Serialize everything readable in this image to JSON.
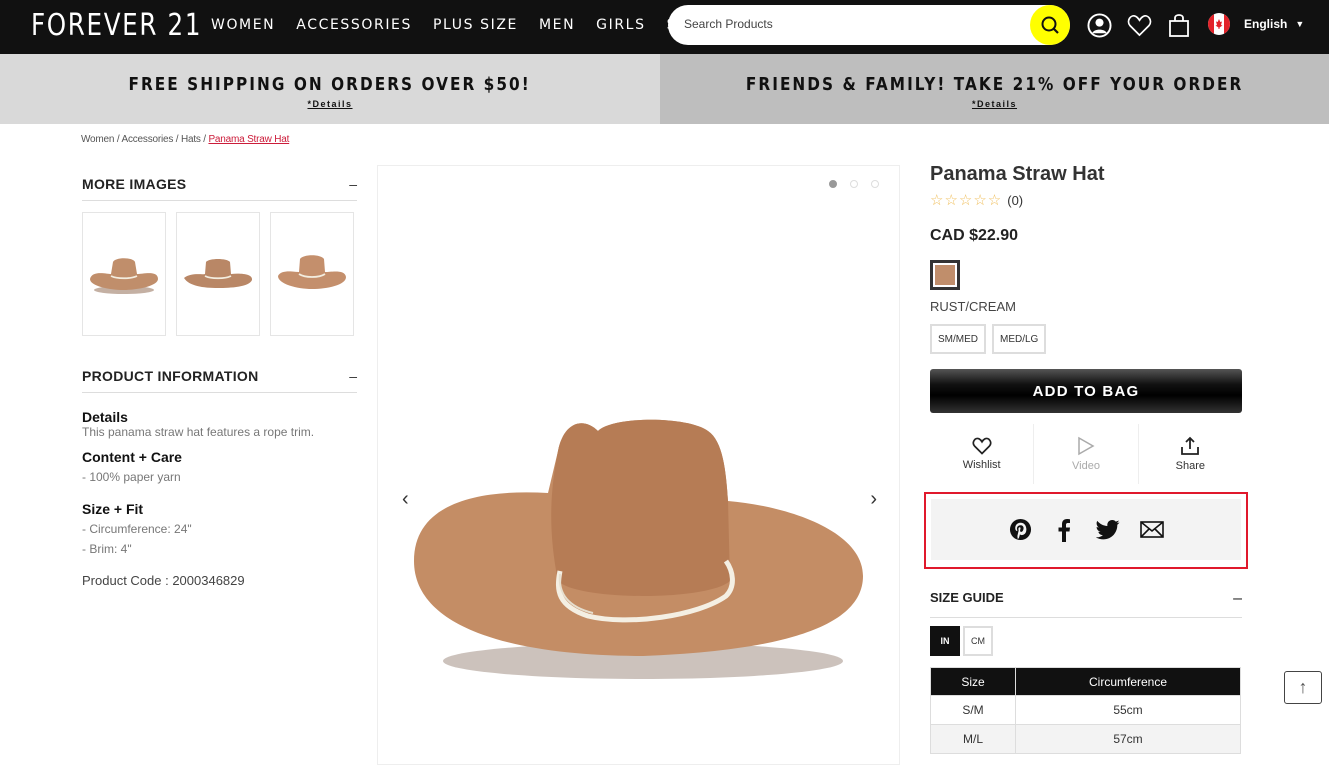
{
  "header": {
    "logo": "FOREVER 21",
    "nav": [
      "WOMEN",
      "ACCESSORIES",
      "PLUS SIZE",
      "MEN",
      "GIRLS",
      "SALE"
    ],
    "search_placeholder": "Search Products",
    "language": "English",
    "icons": [
      "search-icon",
      "account-icon",
      "heart-icon",
      "bag-icon",
      "canada-flag-icon"
    ]
  },
  "promos": [
    {
      "title": "FREE SHIPPING ON ORDERS OVER $50!",
      "link": "*Details"
    },
    {
      "title": "FRIENDS & FAMILY! TAKE 21% OFF YOUR ORDER",
      "link": "*Details"
    }
  ],
  "breadcrumb": {
    "items": [
      "Women",
      "Accessories",
      "Hats"
    ],
    "separator": " / ",
    "current": "Panama Straw Hat"
  },
  "more_images": {
    "title": "MORE IMAGES",
    "toggle": "–",
    "count": 3
  },
  "product_info": {
    "title": "PRODUCT INFORMATION",
    "toggle": "–",
    "details_heading": "Details",
    "details_text": "This panama straw hat features a rope trim.",
    "content_heading": "Content + Care",
    "content_items": [
      "- 100% paper yarn"
    ],
    "fit_heading": "Size + Fit",
    "fit_items": [
      "- Circumference: 24\"",
      "- Brim: 4\""
    ],
    "product_code": "Product Code : 2000346829"
  },
  "gallery": {
    "dots": 3,
    "active_dot": 0,
    "prev": "‹",
    "next": "›"
  },
  "product": {
    "title": "Panama Straw Hat",
    "stars": "☆☆☆☆☆",
    "rating_value": 0,
    "review_count": "(0)",
    "price": "CAD $22.90",
    "swatch_color": "#c08e6b",
    "color_name": "RUST/CREAM",
    "sizes": [
      "SM/MED",
      "MED/LG"
    ],
    "add_to_bag": "ADD TO BAG",
    "actions": [
      {
        "label": "Wishlist",
        "icon": "heart-icon",
        "enabled": true
      },
      {
        "label": "Video",
        "icon": "play-icon",
        "enabled": false
      },
      {
        "label": "Share",
        "icon": "share-icon",
        "enabled": true
      }
    ],
    "share_icons": [
      "pinterest-icon",
      "facebook-icon",
      "twitter-icon",
      "email-icon"
    ]
  },
  "size_guide": {
    "title": "SIZE GUIDE",
    "toggle": "–",
    "units": [
      "IN",
      "CM"
    ],
    "active_unit": "IN",
    "columns": [
      "Size",
      "Circumference"
    ],
    "rows": [
      [
        "S/M",
        "55cm"
      ],
      [
        "M/L",
        "57cm"
      ]
    ]
  },
  "back_to_top": "↑",
  "colors": {
    "header_bg": "#111111",
    "search_accent": "#ffff00",
    "breadcrumb_active": "#cc1c3a",
    "share_highlight": "#e0192c"
  }
}
